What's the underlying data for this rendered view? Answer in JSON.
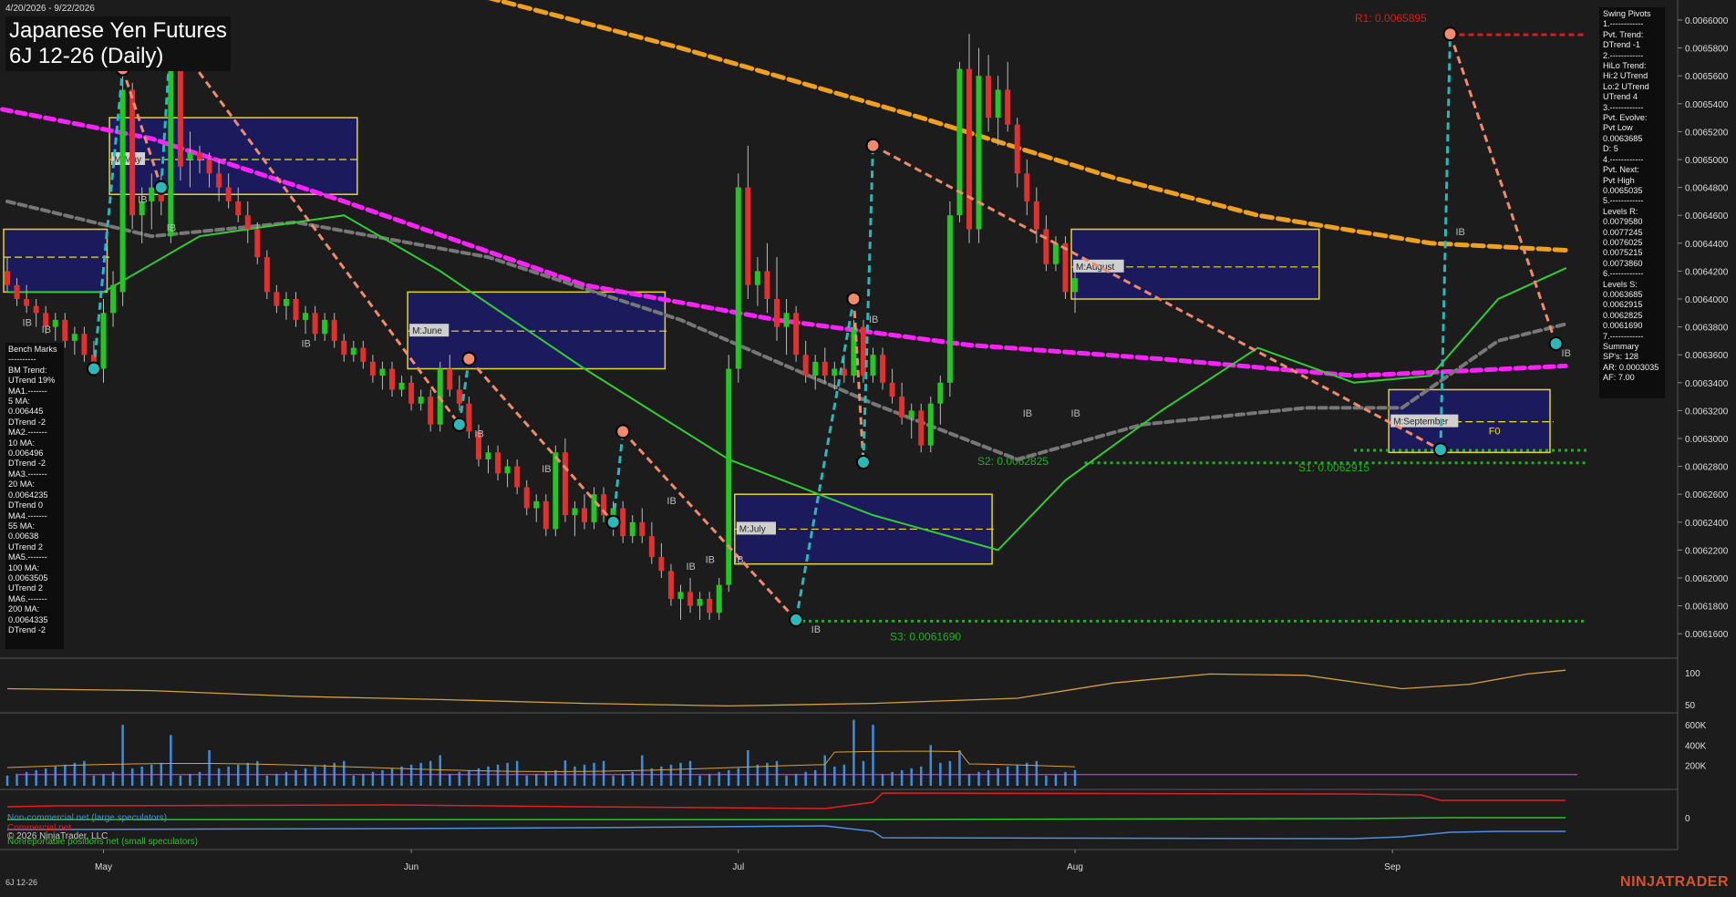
{
  "header": {
    "date_range": "4/20/2026 - 9/22/2026",
    "title": "Japanese Yen Futures",
    "subtitle": "6J 12-26 (Daily)"
  },
  "chart_data": {
    "type": "candlestick",
    "price_axis": {
      "ylim": [
        0.00615,
        0.00662
      ],
      "ticks": [
        "0.0066000",
        "0.0065800",
        "0.0065600",
        "0.0065400",
        "0.0065200",
        "0.0065000",
        "0.0064800",
        "0.0064600",
        "0.0064400",
        "0.0064200",
        "0.0064000",
        "0.0063800",
        "0.0063600",
        "0.0063400",
        "0.0063200",
        "0.0063000",
        "0.0062800",
        "0.0062600",
        "0.0062400",
        "0.0062200",
        "0.0062000",
        "0.0061800",
        "0.0061600"
      ]
    },
    "x_axis": {
      "labels": [
        "May",
        "Jun",
        "Jul",
        "Aug",
        "Sep"
      ],
      "label_days": [
        10,
        42,
        76,
        111,
        144
      ]
    },
    "candles": [
      [
        0.00642,
        0.00643,
        0.006405,
        0.00641
      ],
      [
        0.00641,
        0.006415,
        0.006395,
        0.0064
      ],
      [
        0.0064,
        0.00641,
        0.00639,
        0.006395
      ],
      [
        0.006395,
        0.0064,
        0.00638,
        0.00639
      ],
      [
        0.00639,
        0.006395,
        0.006375,
        0.00638
      ],
      [
        0.00638,
        0.00639,
        0.00637,
        0.006385
      ],
      [
        0.006385,
        0.00639,
        0.006365,
        0.00637
      ],
      [
        0.00637,
        0.00638,
        0.00636,
        0.006375
      ],
      [
        0.006375,
        0.00638,
        0.006355,
        0.00636
      ],
      [
        0.00636,
        0.00637,
        0.006345,
        0.00635
      ],
      [
        0.00635,
        0.0064,
        0.00634,
        0.00639
      ],
      [
        0.00639,
        0.00642,
        0.00638,
        0.00641
      ],
      [
        0.006405,
        0.00656,
        0.006395,
        0.00655
      ],
      [
        0.00655,
        0.006555,
        0.00645,
        0.00646
      ],
      [
        0.00646,
        0.00648,
        0.00644,
        0.00647
      ],
      [
        0.00647,
        0.00649,
        0.00645,
        0.00648
      ],
      [
        0.00648,
        0.00649,
        0.00646,
        0.00647
      ],
      [
        0.006445,
        0.00659,
        0.00644,
        0.006575
      ],
      [
        0.006575,
        0.00658,
        0.006485,
        0.006495
      ],
      [
        0.0065,
        0.00652,
        0.00648,
        0.006505
      ],
      [
        0.006505,
        0.00651,
        0.00649,
        0.0065
      ],
      [
        0.0065,
        0.006505,
        0.00648,
        0.00649
      ],
      [
        0.00649,
        0.0065,
        0.00647,
        0.00648
      ],
      [
        0.00648,
        0.00649,
        0.006465,
        0.00647
      ],
      [
        0.00647,
        0.00648,
        0.006455,
        0.00646
      ],
      [
        0.00646,
        0.00647,
        0.00644,
        0.00645
      ],
      [
        0.00645,
        0.006455,
        0.006425,
        0.00643
      ],
      [
        0.00643,
        0.006435,
        0.0064,
        0.006405
      ],
      [
        0.006405,
        0.00641,
        0.00639,
        0.006395
      ],
      [
        0.006395,
        0.006405,
        0.006385,
        0.0064
      ],
      [
        0.0064,
        0.006405,
        0.00638,
        0.006385
      ],
      [
        0.006385,
        0.006395,
        0.006375,
        0.00639
      ],
      [
        0.00639,
        0.006395,
        0.00637,
        0.006375
      ],
      [
        0.006375,
        0.00639,
        0.00637,
        0.006385
      ],
      [
        0.006385,
        0.00639,
        0.006365,
        0.00637
      ],
      [
        0.00637,
        0.006375,
        0.006355,
        0.00636
      ],
      [
        0.00636,
        0.00637,
        0.006355,
        0.006365
      ],
      [
        0.006365,
        0.00637,
        0.00635,
        0.006355
      ],
      [
        0.006355,
        0.00636,
        0.00634,
        0.006345
      ],
      [
        0.006345,
        0.006355,
        0.006335,
        0.00635
      ],
      [
        0.00635,
        0.006355,
        0.00633,
        0.006335
      ],
      [
        0.006335,
        0.006345,
        0.00633,
        0.00634
      ],
      [
        0.00634,
        0.006345,
        0.00632,
        0.006325
      ],
      [
        0.006325,
        0.006335,
        0.00632,
        0.00633
      ],
      [
        0.00633,
        0.006335,
        0.006305,
        0.00631
      ],
      [
        0.00631,
        0.006355,
        0.006305,
        0.00635
      ],
      [
        0.00635,
        0.00636,
        0.00633,
        0.006335
      ],
      [
        0.006335,
        0.006345,
        0.00632,
        0.006325
      ],
      [
        0.006325,
        0.00633,
        0.0063,
        0.006305
      ],
      [
        0.006305,
        0.00631,
        0.00628,
        0.006285
      ],
      [
        0.006285,
        0.006295,
        0.006275,
        0.00629
      ],
      [
        0.00629,
        0.006295,
        0.00627,
        0.006275
      ],
      [
        0.006275,
        0.006285,
        0.006265,
        0.00628
      ],
      [
        0.00628,
        0.006285,
        0.00626,
        0.006265
      ],
      [
        0.006265,
        0.00627,
        0.006245,
        0.00625
      ],
      [
        0.00625,
        0.00626,
        0.00624,
        0.006255
      ],
      [
        0.006255,
        0.00626,
        0.00623,
        0.006235
      ],
      [
        0.006235,
        0.006295,
        0.00623,
        0.00629
      ],
      [
        0.00629,
        0.0063,
        0.00624,
        0.006245
      ],
      [
        0.006245,
        0.006255,
        0.00623,
        0.00625
      ],
      [
        0.00625,
        0.00626,
        0.006235,
        0.00624
      ],
      [
        0.00624,
        0.006265,
        0.006235,
        0.00626
      ],
      [
        0.00626,
        0.006265,
        0.00624,
        0.006245
      ],
      [
        0.006245,
        0.006255,
        0.00623,
        0.00625
      ],
      [
        0.00625,
        0.006255,
        0.006225,
        0.00623
      ],
      [
        0.00623,
        0.006245,
        0.006225,
        0.00624
      ],
      [
        0.00624,
        0.00625,
        0.006225,
        0.00623
      ],
      [
        0.00623,
        0.00624,
        0.00621,
        0.006215
      ],
      [
        0.006215,
        0.006225,
        0.0062,
        0.006205
      ],
      [
        0.006205,
        0.00621,
        0.00618,
        0.006185
      ],
      [
        0.006185,
        0.006195,
        0.00617,
        0.00619
      ],
      [
        0.00619,
        0.0062,
        0.006175,
        0.00618
      ],
      [
        0.00618,
        0.00619,
        0.00617,
        0.006185
      ],
      [
        0.006185,
        0.00619,
        0.00617,
        0.006175
      ],
      [
        0.006175,
        0.0062,
        0.00617,
        0.006195
      ],
      [
        0.006195,
        0.00636,
        0.00619,
        0.00635
      ],
      [
        0.00635,
        0.00649,
        0.00634,
        0.00648
      ],
      [
        0.00648,
        0.00651,
        0.0064,
        0.00641
      ],
      [
        0.00641,
        0.00643,
        0.006395,
        0.00642
      ],
      [
        0.00642,
        0.00644,
        0.00639,
        0.0064
      ],
      [
        0.0064,
        0.00643,
        0.00637,
        0.00638
      ],
      [
        0.00638,
        0.0064,
        0.00636,
        0.00639
      ],
      [
        0.00639,
        0.006395,
        0.006355,
        0.00636
      ],
      [
        0.00636,
        0.00637,
        0.00634,
        0.006345
      ],
      [
        0.006345,
        0.00636,
        0.006335,
        0.006355
      ],
      [
        0.006355,
        0.006365,
        0.00634,
        0.006345
      ],
      [
        0.006345,
        0.006355,
        0.006335,
        0.00635
      ],
      [
        0.00635,
        0.00636,
        0.00634,
        0.006345
      ],
      [
        0.006345,
        0.006385,
        0.00634,
        0.00638
      ],
      [
        0.00638,
        0.006385,
        0.00634,
        0.006345
      ],
      [
        0.006345,
        0.006365,
        0.00634,
        0.00636
      ],
      [
        0.00636,
        0.006365,
        0.006335,
        0.00634
      ],
      [
        0.00634,
        0.00635,
        0.006325,
        0.00633
      ],
      [
        0.00633,
        0.00634,
        0.00631,
        0.006315
      ],
      [
        0.006315,
        0.006325,
        0.0063,
        0.00632
      ],
      [
        0.00632,
        0.006325,
        0.00629,
        0.006295
      ],
      [
        0.006295,
        0.00633,
        0.00629,
        0.006325
      ],
      [
        0.006325,
        0.006345,
        0.00631,
        0.00634
      ],
      [
        0.00634,
        0.00647,
        0.00633,
        0.00646
      ],
      [
        0.00646,
        0.00657,
        0.006455,
        0.006565
      ],
      [
        0.006565,
        0.00659,
        0.00644,
        0.00645
      ],
      [
        0.00645,
        0.00658,
        0.00644,
        0.00656
      ],
      [
        0.00656,
        0.006575,
        0.00652,
        0.00653
      ],
      [
        0.00653,
        0.00656,
        0.00651,
        0.00655
      ],
      [
        0.00655,
        0.00657,
        0.00652,
        0.006525
      ],
      [
        0.006525,
        0.00653,
        0.00648,
        0.00649
      ],
      [
        0.00649,
        0.0065,
        0.00646,
        0.00647
      ],
      [
        0.00647,
        0.00648,
        0.00644,
        0.00645
      ],
      [
        0.00645,
        0.00646,
        0.00642,
        0.006425
      ],
      [
        0.006425,
        0.006445,
        0.00642,
        0.00644
      ],
      [
        0.00644,
        0.006445,
        0.0064,
        0.006405
      ],
      [
        0.006405,
        0.00642,
        0.00639,
        0.006415
      ]
    ],
    "levels": [
      {
        "label": "R1: 0.0065895",
        "value": 0.0065895,
        "color": "#e01818"
      },
      {
        "label": "S1: 0.0062915",
        "value": 0.0062825,
        "color": "#22b022"
      },
      {
        "label": "S2: 0.0062825",
        "value": 0.0062915,
        "color": "#22b022"
      },
      {
        "label": "S3: 0.0061690",
        "value": 0.006169,
        "color": "#22b022"
      }
    ],
    "month_boxes": [
      {
        "label": "M:May",
        "hi": 0.00653,
        "lo": 0.006475,
        "start": 11,
        "end": 36,
        "mid": 0.0065
      },
      {
        "label": "M:June",
        "hi": 0.006405,
        "lo": 0.00635,
        "start": 42,
        "end": 68,
        "mid": 0.006377
      },
      {
        "label": "M:July",
        "hi": 0.00626,
        "lo": 0.00621,
        "start": 76,
        "end": 102,
        "mid": 0.006235
      },
      {
        "label": "M:August",
        "hi": 0.00645,
        "lo": 0.0064,
        "start": 111,
        "end": 136,
        "mid": 0.006423
      },
      {
        "label": "M:September",
        "hi": 0.006335,
        "lo": 0.00629,
        "start": 144,
        "end": 160,
        "mid": 0.006312
      },
      {
        "label": "",
        "hi": 0.00645,
        "lo": 0.006405,
        "start": 0,
        "end": 10,
        "mid": 0.00643
      }
    ],
    "ib_labels": [
      "IB",
      "IB",
      "IB",
      "IB",
      "IB",
      "IB",
      "IB",
      "IB",
      "IB",
      "IB",
      "IB",
      "IB",
      "IB",
      "IB",
      "IB",
      "IB",
      "IB"
    ],
    "f0_label": "F0",
    "oscillator": {
      "ticks": [
        "100",
        "50"
      ]
    },
    "volume": {
      "ticks": [
        "600K",
        "400K",
        "200K"
      ]
    },
    "cot": {
      "ticks": [
        "0"
      ],
      "series": [
        {
          "name": "Non-commercial net (large speculators)",
          "color": "#4d8fe0"
        },
        {
          "name": "Commercial net",
          "color": "#e02020"
        },
        {
          "name": "Nonreportable positions net (small speculators)",
          "color": "#2ec02e"
        }
      ]
    }
  },
  "bench_marks": [
    "Bench Marks",
    "----------",
    "BM Trend:",
    "UTrend 19%",
    "MA1.-------",
    "5 MA:",
    "0.006445",
    "DTrend -2",
    "MA2.-------",
    "10 MA:",
    "0.006496",
    "DTrend -2",
    "MA3.-------",
    "20 MA:",
    "0.0064235",
    "DTrend 0",
    "MA4.-------",
    "55 MA:",
    "0.00638",
    "UTrend 2",
    "MA5.-------",
    "100 MA:",
    "0.0063505",
    "UTrend 2",
    "MA6.-------",
    "200 MA:",
    "0.0064335",
    "DTrend -2"
  ],
  "swing_pivots": [
    "Swing Pivots",
    "1.------------",
    "Pvt. Trend:",
    "DTrend -1",
    "2.------------",
    "HiLo Trend:",
    "Hi:2 UTrend",
    "Lo:2 UTrend",
    "UTrend 4",
    "3.------------",
    "Pvt. Evolve:",
    "Pvt Low",
    "0.0063685",
    "D: 5",
    "4.------------",
    "Pvt. Next:",
    "Pvt High",
    "0.0065035",
    "5.------------",
    "Levels R:",
    "0.0079580",
    "0.0077245",
    "0.0076025",
    "0.0075215",
    "0.0073860",
    "6.------------",
    "Levels S:",
    "0.0063685",
    "0.0062915",
    "0.0062825",
    "0.0061690",
    "7.------------",
    "Summary",
    "SP's: 128",
    "AR: 0.0003035",
    "AF: 7.00"
  ],
  "copyright": "© 2026 NinjaTrader, LLC",
  "footer_symbol": "6J 12-26",
  "brand": "NINJATRADER",
  "colors": {
    "background": "#1c1c1c",
    "up": "#22c822",
    "down": "#e03030",
    "grid": "#333333",
    "ma_magenta": "#ff22ff",
    "ma_orange": "#f0a020",
    "ma_gray": "#777777",
    "ma_green": "#33cc33",
    "swing_up": "#2ab8b8",
    "swing_down": "#f08a6a",
    "month_box": "#f0e020",
    "month_fill": "#1a1a60"
  }
}
